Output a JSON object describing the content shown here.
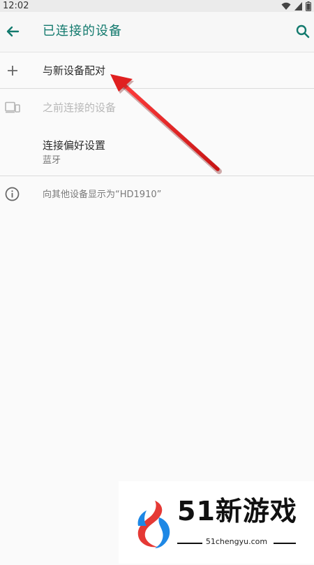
{
  "status_bar": {
    "time": "12:02",
    "icons": [
      "wifi-icon",
      "signal-icon",
      "battery-icon"
    ]
  },
  "app_bar": {
    "title": "已连接的设备",
    "back_icon": "arrow-back-icon",
    "search_icon": "search-icon",
    "accent_color": "#137a6e"
  },
  "list": {
    "pair_new": "与新设备配对",
    "previously_connected": "之前连接的设备",
    "connection_prefs": {
      "title": "连接偏好设置",
      "subtitle": "蓝牙"
    },
    "visibility_info": "向其他设备显示为“HD1910”"
  },
  "annotation": {
    "arrow_color": "#e02020"
  },
  "watermark": {
    "brand": "51新游戏",
    "url": "51chengyu.com"
  }
}
